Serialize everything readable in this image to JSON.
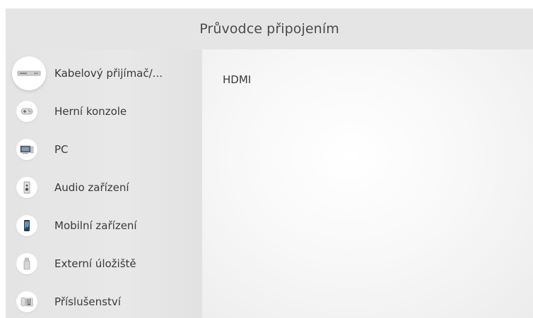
{
  "header": {
    "title": "Průvodce připojením"
  },
  "sidebar": {
    "items": [
      {
        "label": "Kabelový přijímač/...",
        "icon": "cable-box-icon"
      },
      {
        "label": "Herní konzole",
        "icon": "gamepad-icon"
      },
      {
        "label": "PC",
        "icon": "monitor-icon"
      },
      {
        "label": "Audio zařízení",
        "icon": "speaker-icon"
      },
      {
        "label": "Mobilní zařízení",
        "icon": "smartphone-icon"
      },
      {
        "label": "Externí úložiště",
        "icon": "usb-drive-icon"
      },
      {
        "label": "Příslušenství",
        "icon": "keyboard-icon"
      }
    ]
  },
  "content": {
    "connection_type": "HDMI"
  },
  "colors": {
    "background": "#e3e3e3",
    "text": "#3a3a3a",
    "icon_bg": "#ffffff"
  }
}
